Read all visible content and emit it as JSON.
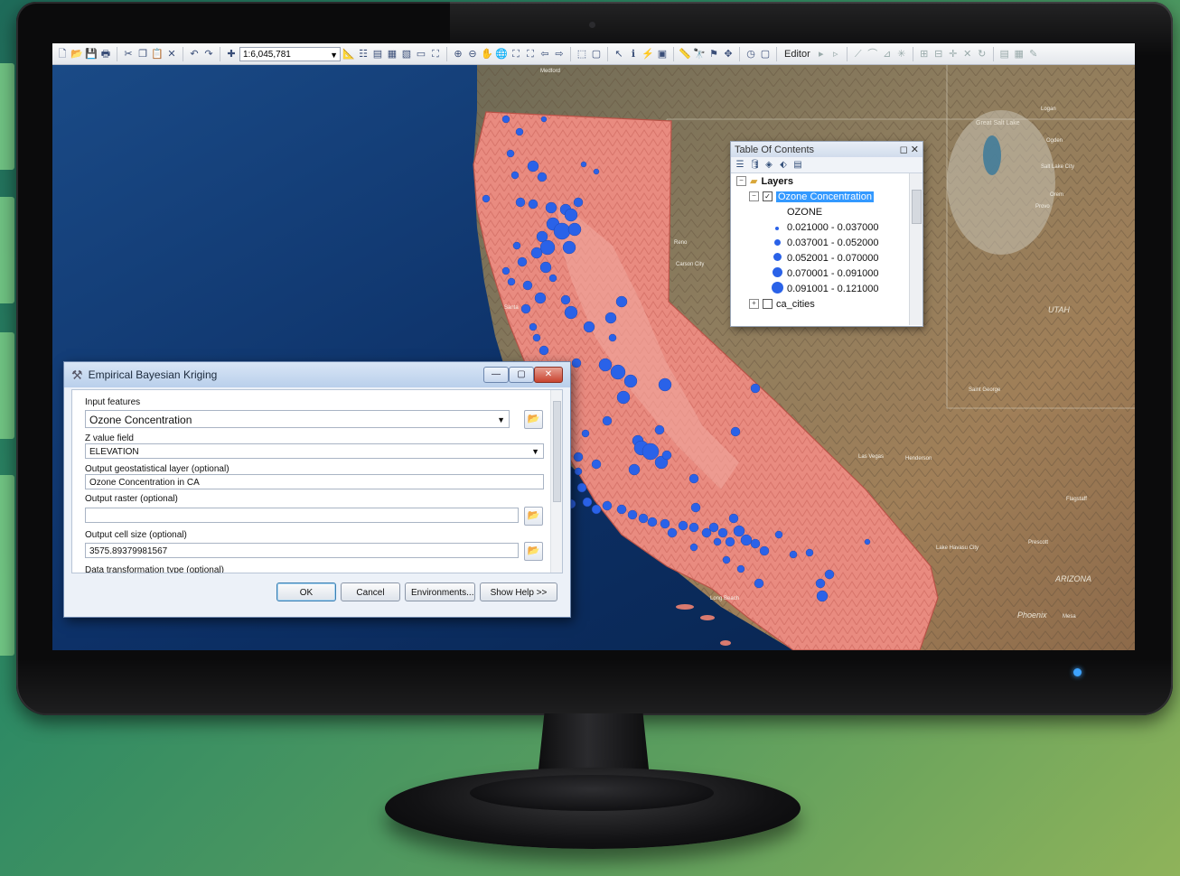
{
  "toolbar": {
    "scale": "1:6,045,781",
    "editor_label": "Editor"
  },
  "map": {
    "labels": {
      "medford": "Medford",
      "logan": "Logan",
      "ogden": "Ogden",
      "great_salt_lake": "Great Salt Lake",
      "salt_lake_city": "Salt Lake City",
      "orem": "Orem",
      "provo": "Provo",
      "reno": "Reno",
      "carson_city": "Carson City",
      "utah": "UTAH",
      "santa_rosa": "Santa",
      "saint_george": "Saint George",
      "las_vegas": "Las Vegas",
      "henderson": "Henderson",
      "flagstaff": "Flagstaff",
      "lake_havasu": "Lake Havasu City",
      "prescott": "Prescott",
      "arizona": "ARIZONA",
      "long_beach": "Long Beach",
      "phoenix": "Phoenix",
      "mesa": "Mesa"
    },
    "colors": {
      "ocean": "#0f3a6e",
      "california": "#e98b80",
      "points": "#2a62e8"
    }
  },
  "toc": {
    "title": "Table Of Contents",
    "layers_label": "Layers",
    "layer_name": "Ozone Concentration",
    "field_name": "OZONE",
    "classes": [
      "0.021000 - 0.037000",
      "0.037001 - 0.052000",
      "0.052001 - 0.070000",
      "0.070001 - 0.091000",
      "0.091001 - 0.121000"
    ],
    "next_layer": "ca_cities"
  },
  "dialog": {
    "title": "Empirical Bayesian Kriging",
    "fields": {
      "input_features_label": "Input features",
      "input_features_value": "Ozone Concentration",
      "z_field_label": "Z value field",
      "z_field_value": "ELEVATION",
      "out_layer_label": "Output geostatistical layer (optional)",
      "out_layer_value": "Ozone Concentration in CA",
      "out_raster_label": "Output raster (optional)",
      "out_raster_value": "",
      "cell_size_label": "Output cell size (optional)",
      "cell_size_value": "3575.89379981567",
      "transform_label": "Data transformation type (optional)"
    },
    "buttons": {
      "ok": "OK",
      "cancel": "Cancel",
      "environments": "Environments...",
      "show_help": "Show Help >>"
    }
  }
}
